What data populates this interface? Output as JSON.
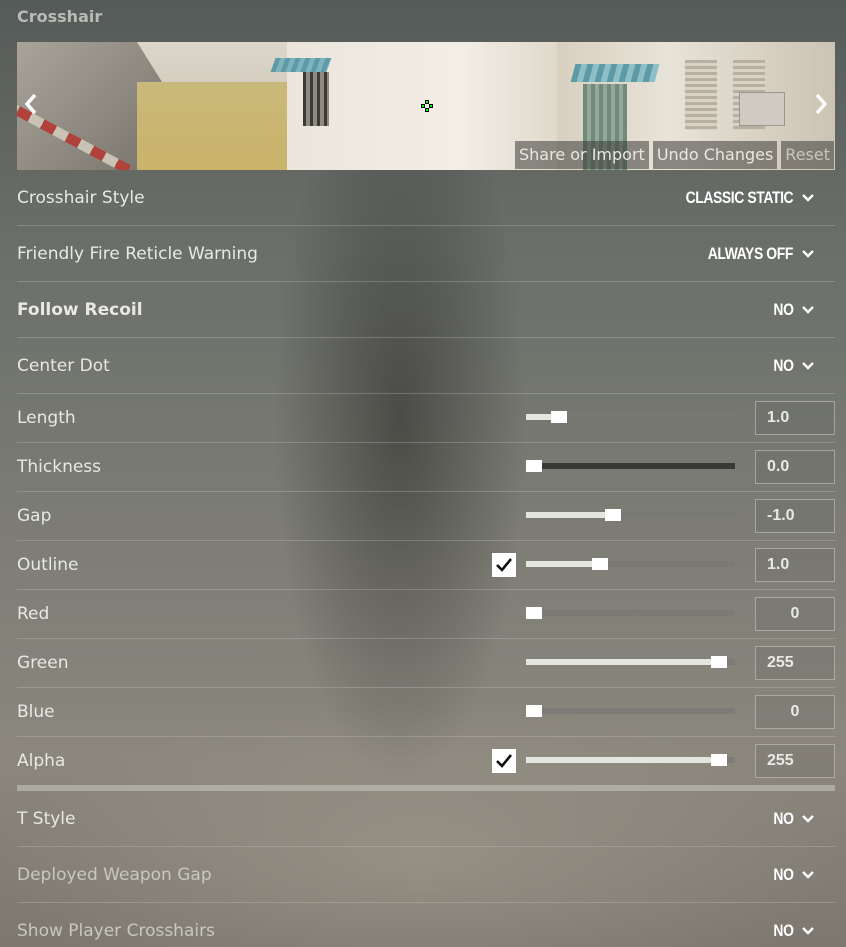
{
  "section_title": "Crosshair",
  "preview": {
    "buttons": [
      "Share or Import",
      "Undo Changes",
      "Reset"
    ],
    "prev_arrow": "chevron-left-icon",
    "next_arrow": "chevron-right-icon"
  },
  "dropdown_rows": [
    {
      "label": "Crosshair Style",
      "value": "CLASSIC STATIC"
    },
    {
      "label": "Friendly Fire Reticle Warning",
      "value": "ALWAYS OFF"
    },
    {
      "label": "Follow Recoil",
      "value": "NO"
    },
    {
      "label": "Center Dot",
      "value": "NO"
    }
  ],
  "slider_rows": [
    {
      "label": "Length",
      "value": "1.0",
      "level": 0.13,
      "has_checkbox": false
    },
    {
      "label": "Thickness",
      "value": "0.0",
      "level": 0.0,
      "has_checkbox": false
    },
    {
      "label": "Gap",
      "value": "-1.0",
      "level": 0.41,
      "has_checkbox": false
    },
    {
      "label": "Outline",
      "value": "1.0",
      "level": 0.34,
      "has_checkbox": true,
      "checked": true
    },
    {
      "label": "Red",
      "value": "0",
      "level": 0.0,
      "has_checkbox": false
    },
    {
      "label": "Green",
      "value": "255",
      "level": 0.96,
      "has_checkbox": false
    },
    {
      "label": "Blue",
      "value": "0",
      "level": 0.0,
      "has_checkbox": false
    },
    {
      "label": "Alpha",
      "value": "255",
      "level": 0.96,
      "has_checkbox": true,
      "checked": true
    }
  ],
  "lower_rows": [
    {
      "label": "T Style",
      "value": "NO"
    },
    {
      "label": "Deployed Weapon Gap",
      "value": "NO"
    },
    {
      "label": "Show Player Crosshairs",
      "value": "NO"
    }
  ],
  "colors": {
    "crosshair": "#00ff00",
    "text": "#e8e8e4",
    "accent": "#ffffff"
  }
}
